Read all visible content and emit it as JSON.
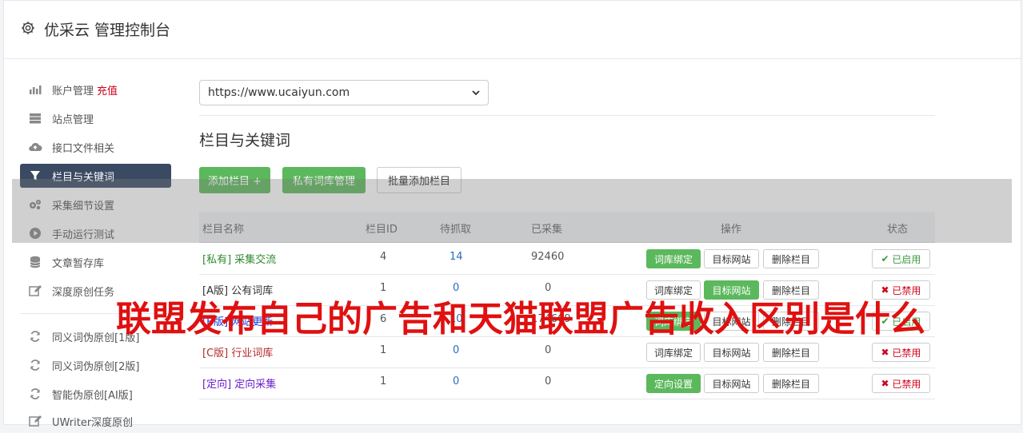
{
  "app": {
    "title": "优采云 管理控制台",
    "icon": "gear-icon"
  },
  "sidebar": {
    "items": [
      {
        "label": "账户管理",
        "badge": "充值",
        "icon": "bar-chart-icon"
      },
      {
        "label": "站点管理",
        "icon": "server-icon"
      },
      {
        "label": "接口文件相关",
        "icon": "cloud-upload-icon"
      },
      {
        "label": "栏目与关键词",
        "icon": "filter-icon",
        "active": true
      },
      {
        "label": "采集细节设置",
        "icon": "gears-icon"
      },
      {
        "label": "手动运行测试",
        "icon": "play-circle-icon"
      },
      {
        "label": "文章暂存库",
        "icon": "database-icon"
      },
      {
        "label": "深度原创任务",
        "icon": "edit-icon"
      },
      {
        "label": "同义词伪原创[1版]",
        "icon": "refresh-icon"
      },
      {
        "label": "同义词伪原创[2版]",
        "icon": "refresh-icon"
      },
      {
        "label": "智能伪原创[AI版]",
        "icon": "refresh-icon"
      },
      {
        "label": "UWriter深度原创",
        "icon": "edit-icon"
      }
    ]
  },
  "site_select": {
    "value": "https://www.ucaiyun.com"
  },
  "section": {
    "title": "栏目与关键词"
  },
  "toolbar": {
    "add_column": "添加栏目 +",
    "private_lib": "私有词库管理",
    "batch_add": "批量添加栏目"
  },
  "table": {
    "headers": {
      "name": "栏目名称",
      "id": "栏目ID",
      "pending": "待抓取",
      "collected": "已采集",
      "ops": "操作",
      "status": "状态"
    },
    "rows": [
      {
        "tag": "[私有]",
        "name": "采集交流",
        "id": "4",
        "pending": "14",
        "collected": "92460",
        "op1": "词库绑定",
        "op2": "目标网站",
        "op3": "删除栏目",
        "status": "已启用"
      },
      {
        "tag": "[A版]",
        "name": "公有词库",
        "id": "1",
        "pending": "0",
        "collected": "0",
        "op1": "词库绑定",
        "op2": "目标网站",
        "op3": "删除栏目",
        "status": "已禁用"
      },
      {
        "tag": "[B版]",
        "name": "网站更新",
        "id": "6",
        "pending": "10",
        "collected": "174669",
        "op1": "词库绑定",
        "op2": "目标网站",
        "op3": "删除栏目",
        "status": "已启用"
      },
      {
        "tag": "[C版]",
        "name": "行业词库",
        "id": "1",
        "pending": "0",
        "collected": "0",
        "op1": "词库绑定",
        "op2": "目标网站",
        "op3": "删除栏目",
        "status": "已禁用"
      },
      {
        "tag": "[定向]",
        "name": "定向采集",
        "id": "1",
        "pending": "0",
        "collected": "0",
        "op1": "定向设置",
        "op2": "目标网站",
        "op3": "删除栏目",
        "status": "已禁用"
      }
    ]
  },
  "overlay": {
    "text": "联盟发布自己的广告和天猫联盟广告收入区别是什么"
  },
  "colors": {
    "primary_green": "#5cb85c",
    "sidebar_active": "#3a4a63",
    "danger": "#d0021b",
    "link_blue": "#2a6ebb"
  }
}
